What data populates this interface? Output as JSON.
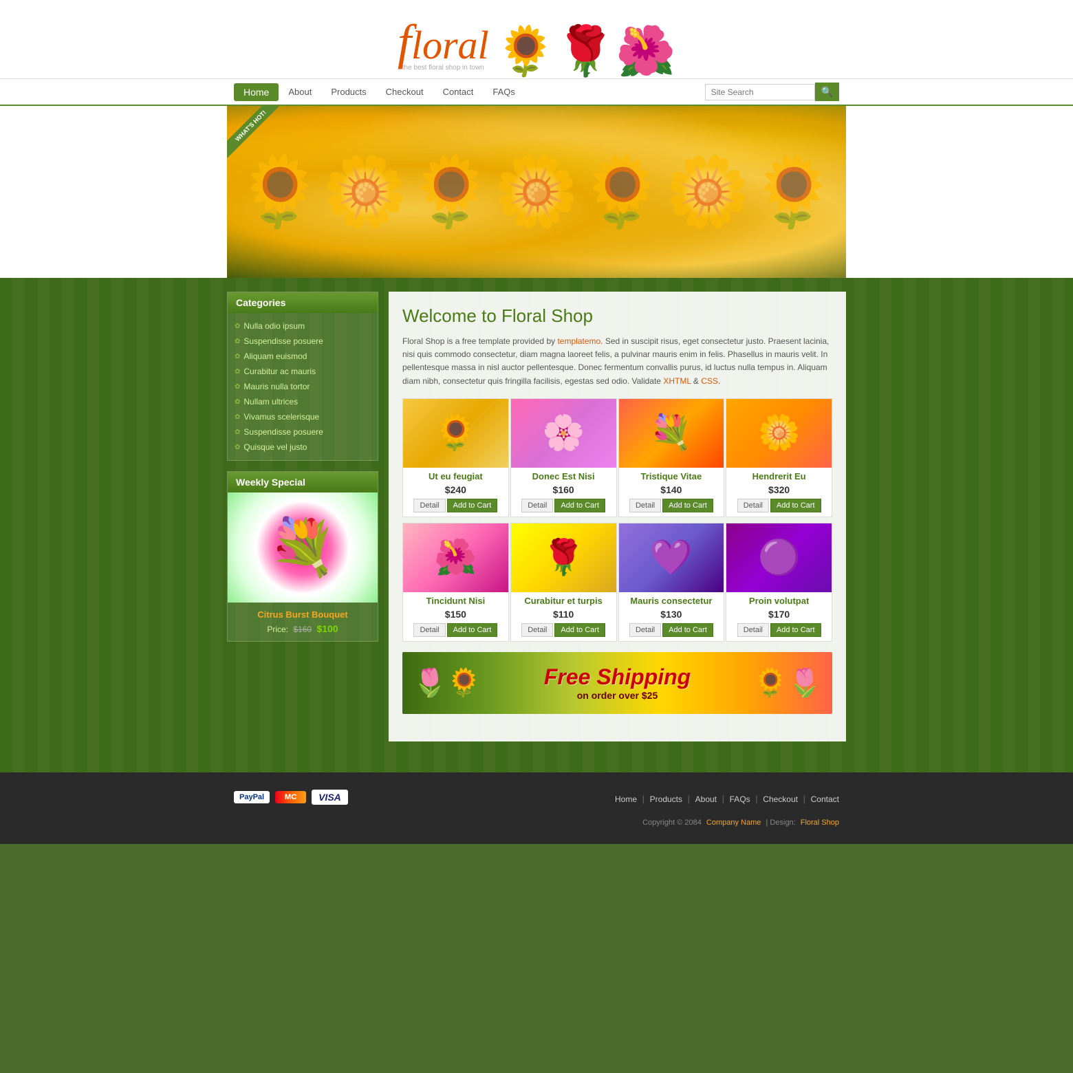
{
  "site": {
    "title": "Floral Shop",
    "tagline": "the best floral shop in town"
  },
  "nav": {
    "items": [
      {
        "label": "Home",
        "active": true
      },
      {
        "label": "About",
        "active": false
      },
      {
        "label": "Products",
        "active": false
      },
      {
        "label": "Checkout",
        "active": false
      },
      {
        "label": "Contact",
        "active": false
      },
      {
        "label": "FAQs",
        "active": false
      }
    ],
    "search_placeholder": "Site Search"
  },
  "hero": {
    "badge": "WHAT'S HOT!"
  },
  "sidebar": {
    "categories_title": "Categories",
    "categories": [
      {
        "label": "Nulla odio ipsum"
      },
      {
        "label": "Suspendisse posuere"
      },
      {
        "label": "Aliquam euismod"
      },
      {
        "label": "Curabitur ac mauris"
      },
      {
        "label": "Mauris nulla tortor"
      },
      {
        "label": "Nullam ultrices"
      },
      {
        "label": "Vivamus scelerisque"
      },
      {
        "label": "Suspendisse posuere"
      },
      {
        "label": "Quisque vel justo"
      }
    ],
    "weekly_special_title": "Weekly Special",
    "weekly_special": {
      "name": "Citrus Burst Bouquet",
      "price_label": "Price:",
      "old_price": "$160",
      "new_price": "$100"
    }
  },
  "welcome": {
    "title": "Welcome to Floral Shop",
    "text_1": "Floral Shop is a free template provided by",
    "link_templatemo": "templatemo",
    "text_2": ". Sed in suscipit risus, eget consectetur justo. Praesent lacinia, nisi quis commodo consectetur, diam magna laoreet felis, a pulvinar mauris enim in felis. Phasellus in mauris velit. In pellentesque massa in nisl auctor pellentesque. Donec fermentum convallis purus, id luctus nulla tempus in. Aliquam diam nibh, consectetur quis fringilla facilisis, egestas sed odio. Validate",
    "link_xhtml": "XHTML",
    "text_3": "&",
    "link_css": "CSS",
    "text_4": "."
  },
  "products_row1": [
    {
      "name": "Ut eu feugiat",
      "price": "$240",
      "img_type": "roses"
    },
    {
      "name": "Donec Est Nisi",
      "price": "$160",
      "img_type": "pink"
    },
    {
      "name": "Tristique Vitae",
      "price": "$140",
      "img_type": "mixed"
    },
    {
      "name": "Hendrerit Eu",
      "price": "$320",
      "img_type": "orange-bouquet"
    }
  ],
  "products_row2": [
    {
      "name": "Tincidunt Nisi",
      "price": "$150",
      "img_type": "pink-single"
    },
    {
      "name": "Curabitur et turpis",
      "price": "$110",
      "img_type": "yellow-roses"
    },
    {
      "name": "Mauris consectetur",
      "price": "$130",
      "img_type": "purple-tulips"
    },
    {
      "name": "Proin volutpat",
      "price": "$170",
      "img_type": "purple-bouquet"
    }
  ],
  "buttons": {
    "detail": "Detail",
    "add_to_cart": "Add to Cart"
  },
  "shipping": {
    "main": "Free Shipping",
    "sub": "on order over $25"
  },
  "footer": {
    "links": [
      {
        "label": "Home"
      },
      {
        "label": "Products"
      },
      {
        "label": "About"
      },
      {
        "label": "FAQs"
      },
      {
        "label": "Checkout"
      },
      {
        "label": "Contact"
      }
    ],
    "copy_1": "Copyright © 2084",
    "company": "Company Name",
    "copy_2": "| Design:",
    "design": "Floral Shop"
  }
}
